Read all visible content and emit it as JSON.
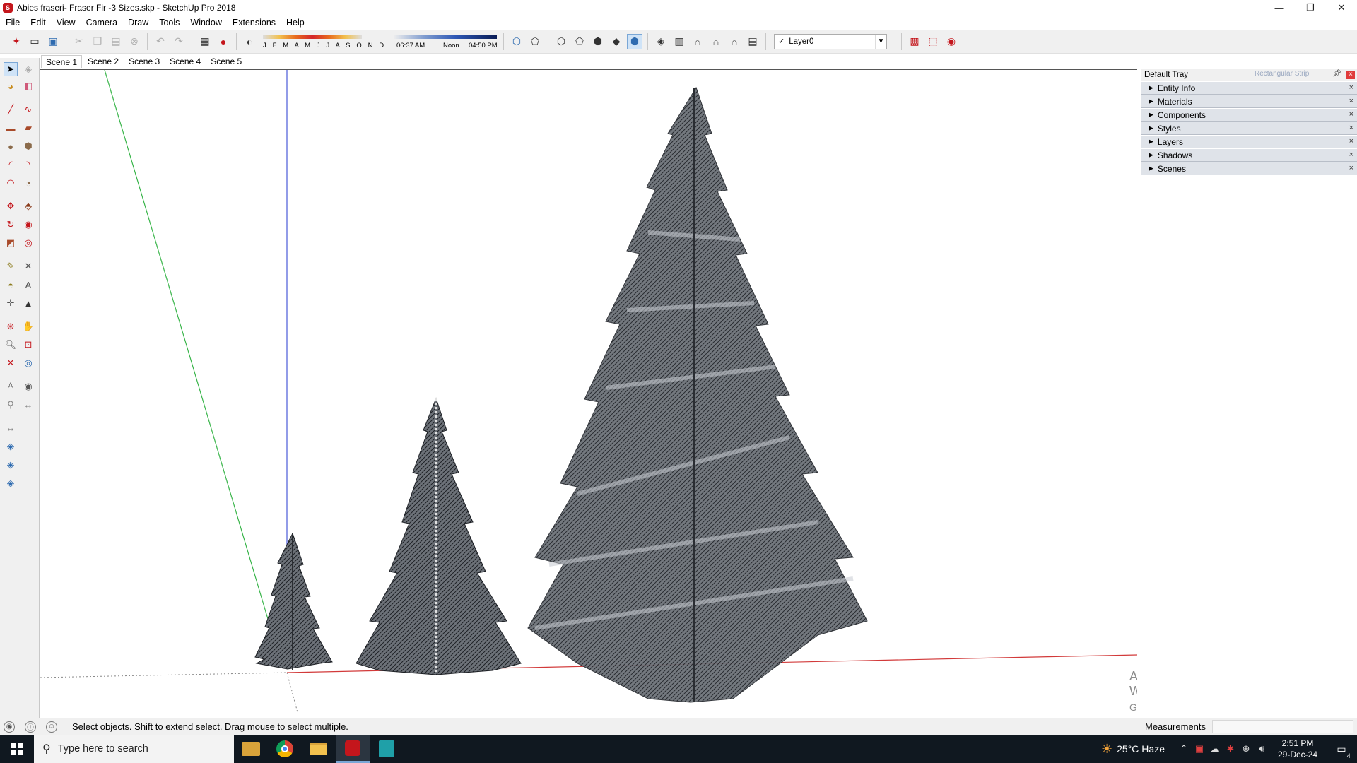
{
  "window": {
    "title": "Abies fraseri- Fraser Fir -3 Sizes.skp - SketchUp Pro 2018",
    "controls": {
      "minimize": "—",
      "restore": "❐",
      "close": "✕"
    }
  },
  "menu": [
    "File",
    "Edit",
    "View",
    "Camera",
    "Draw",
    "Tools",
    "Window",
    "Extensions",
    "Help"
  ],
  "toolbar": {
    "shadow_months": "J F M A M J J A S O N D",
    "time_start": "06:37 AM",
    "time_mid": "Noon",
    "time_end": "04:50 PM",
    "layer_current": "Layer0",
    "layer_check": "✓"
  },
  "scenes": [
    "Scene 1",
    "Scene 2",
    "Scene 3",
    "Scene 4",
    "Scene 5"
  ],
  "active_scene": "Scene 1",
  "tray": {
    "title": "Default Tray",
    "ghost_text": "Rectangular Strip",
    "panels": [
      "Entity Info",
      "Materials",
      "Components",
      "Styles",
      "Layers",
      "Shadows",
      "Scenes"
    ]
  },
  "watermark": {
    "line1": "Activate Windows",
    "line2": "Go to Settings to activate Windows."
  },
  "status": {
    "message": "Select objects. Shift to extend select. Drag mouse to select multiple.",
    "measurements_label": "Measurements",
    "measurements_value": ""
  },
  "taskbar": {
    "search_placeholder": "Type here to search",
    "weather": "25°C  Haze",
    "time": "2:51 PM",
    "date": "29-Dec-24",
    "notification_count": "4"
  },
  "colors": {
    "axis_green": "#39b54a",
    "axis_blue": "#4a5ad8",
    "axis_red": "#d23a3a",
    "tree_dark": "#3a3d42",
    "tree_light": "#8a8f97",
    "taskbar": "#101820"
  }
}
